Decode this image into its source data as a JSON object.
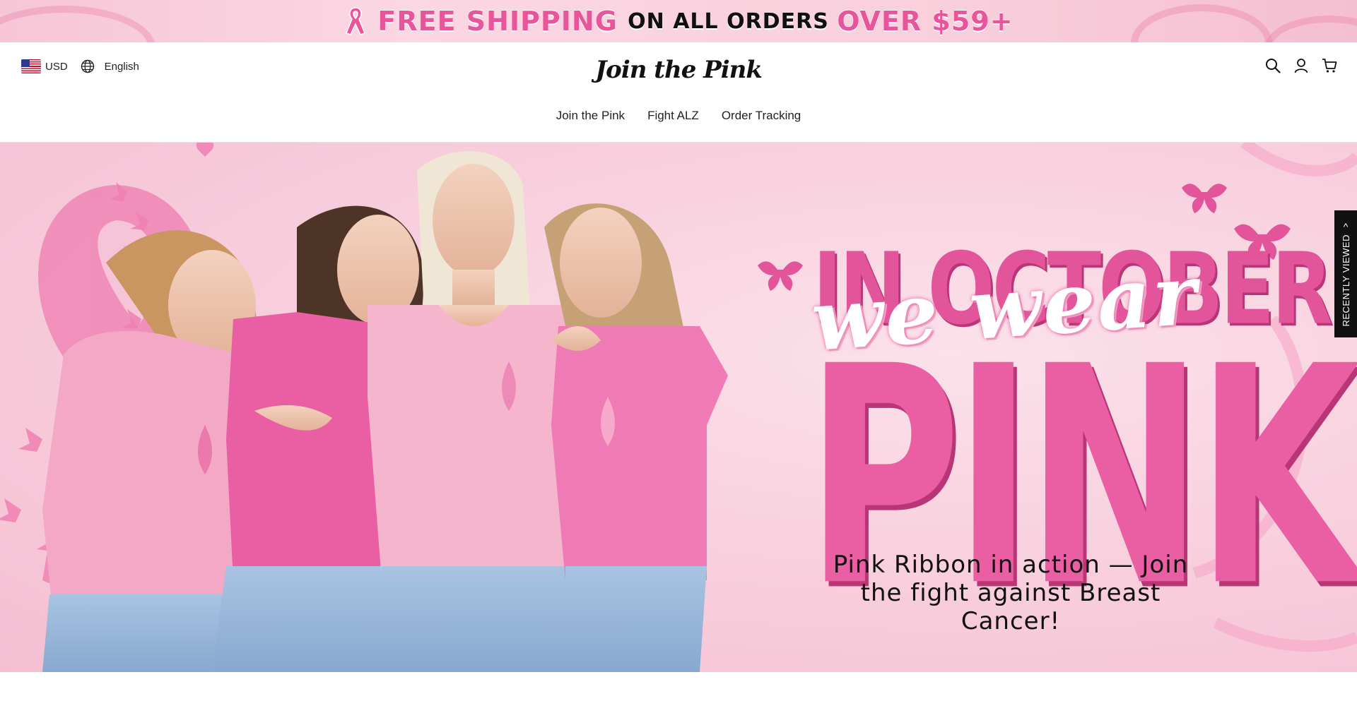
{
  "announcement": {
    "segments": [
      {
        "text": "FREE SHIPPING ",
        "style": "pink"
      },
      {
        "text": "ON ALL ORDERS ",
        "style": "dark"
      },
      {
        "text": "OVER $59+",
        "style": "pink"
      }
    ],
    "icon": "pink-ribbon-icon"
  },
  "header": {
    "currency": {
      "code": "USD",
      "icon": "us-flag-icon"
    },
    "language": {
      "label": "English",
      "icon": "globe-icon"
    },
    "logo_text": "Join the Pink",
    "actions": {
      "search_icon": "search-icon",
      "account_icon": "user-icon",
      "cart_icon": "cart-icon"
    }
  },
  "nav": {
    "items": [
      {
        "label": "Join the Pink"
      },
      {
        "label": "Fight ALZ"
      },
      {
        "label": "Order Tracking"
      }
    ]
  },
  "hero": {
    "title_top": "IN OCTOBER",
    "title_script": "we wear",
    "title_big": "PINK",
    "subtitle_line1": "Pink Ribbon in action — Join",
    "subtitle_line2": "the fight against Breast Cancer!"
  },
  "recently_viewed": {
    "label": "RECENTLY VIEWED",
    "icon": "chevron-up-icon"
  },
  "colors": {
    "accent_pink": "#e8559a",
    "hero_pink": "#ea5ea3",
    "banner_bg": "#fbd7e3",
    "side_tab_bg": "#111111"
  }
}
